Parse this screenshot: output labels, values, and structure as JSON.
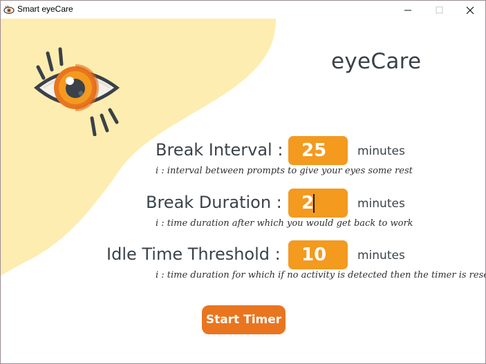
{
  "window": {
    "title": "Smart eyeCare",
    "controls": {
      "minimize_icon": "minimize-icon",
      "maximize_icon": "maximize-icon",
      "close_icon": "close-icon"
    }
  },
  "app": {
    "title": "eyeCare",
    "logo_icon": "eye-icon"
  },
  "fields": [
    {
      "label": "Break Interval :",
      "value": "25",
      "unit": "minutes",
      "hint": "i : interval between prompts to give your eyes some rest"
    },
    {
      "label": "Break Duration :",
      "value": "2",
      "unit": "minutes",
      "hint": "i : time duration after which you would get back to work"
    },
    {
      "label": "Idle Time Threshold :",
      "value": "10",
      "unit": "minutes",
      "hint": "i : time duration for which if no activity is detected then the timer is reset"
    }
  ],
  "actions": {
    "start_label": "Start Timer"
  },
  "colors": {
    "accent_orange": "#f39a1f",
    "button_orange": "#e9751f",
    "background_yellow": "#fdedb0",
    "text_dark": "#3b434a"
  }
}
